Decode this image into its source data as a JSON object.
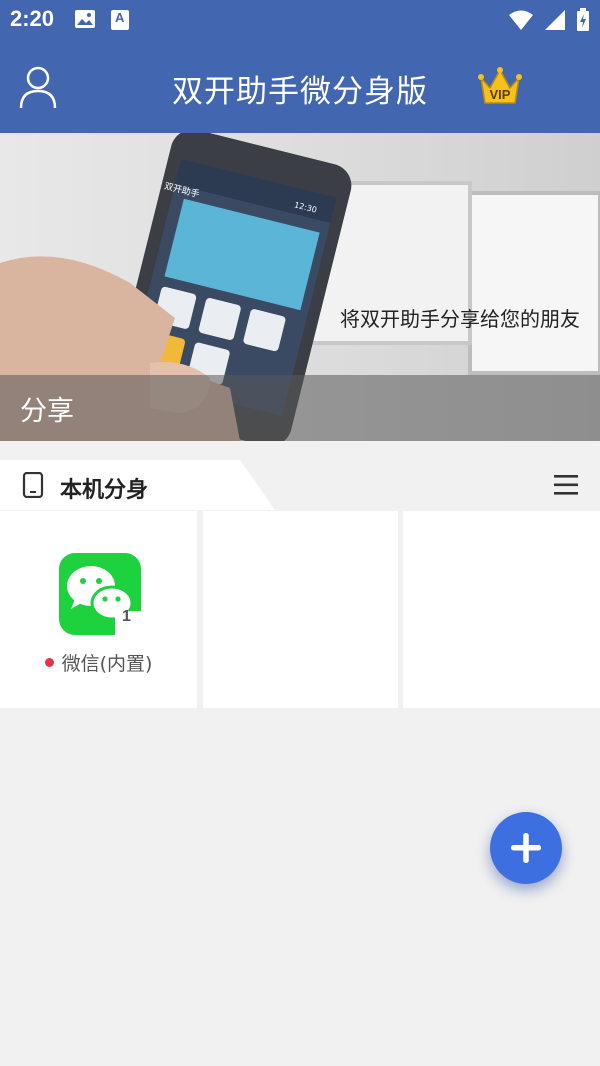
{
  "status_bar": {
    "time": "2:20",
    "badge_letter": "A"
  },
  "header": {
    "title": "双开助手微分身版",
    "vip_text": "VIP"
  },
  "banner": {
    "caption": "将双开助手分享给您的朋友",
    "share_label": "分享",
    "phone_title": "双开助手",
    "phone_time": "12:30"
  },
  "section": {
    "title": "本机分身"
  },
  "apps": [
    {
      "label": "微信(内置)",
      "badge": "1",
      "status_color": "#e53050"
    }
  ],
  "colors": {
    "header": "#4266b0",
    "accent": "#3e6fe0",
    "wechat": "#1ed13e"
  }
}
